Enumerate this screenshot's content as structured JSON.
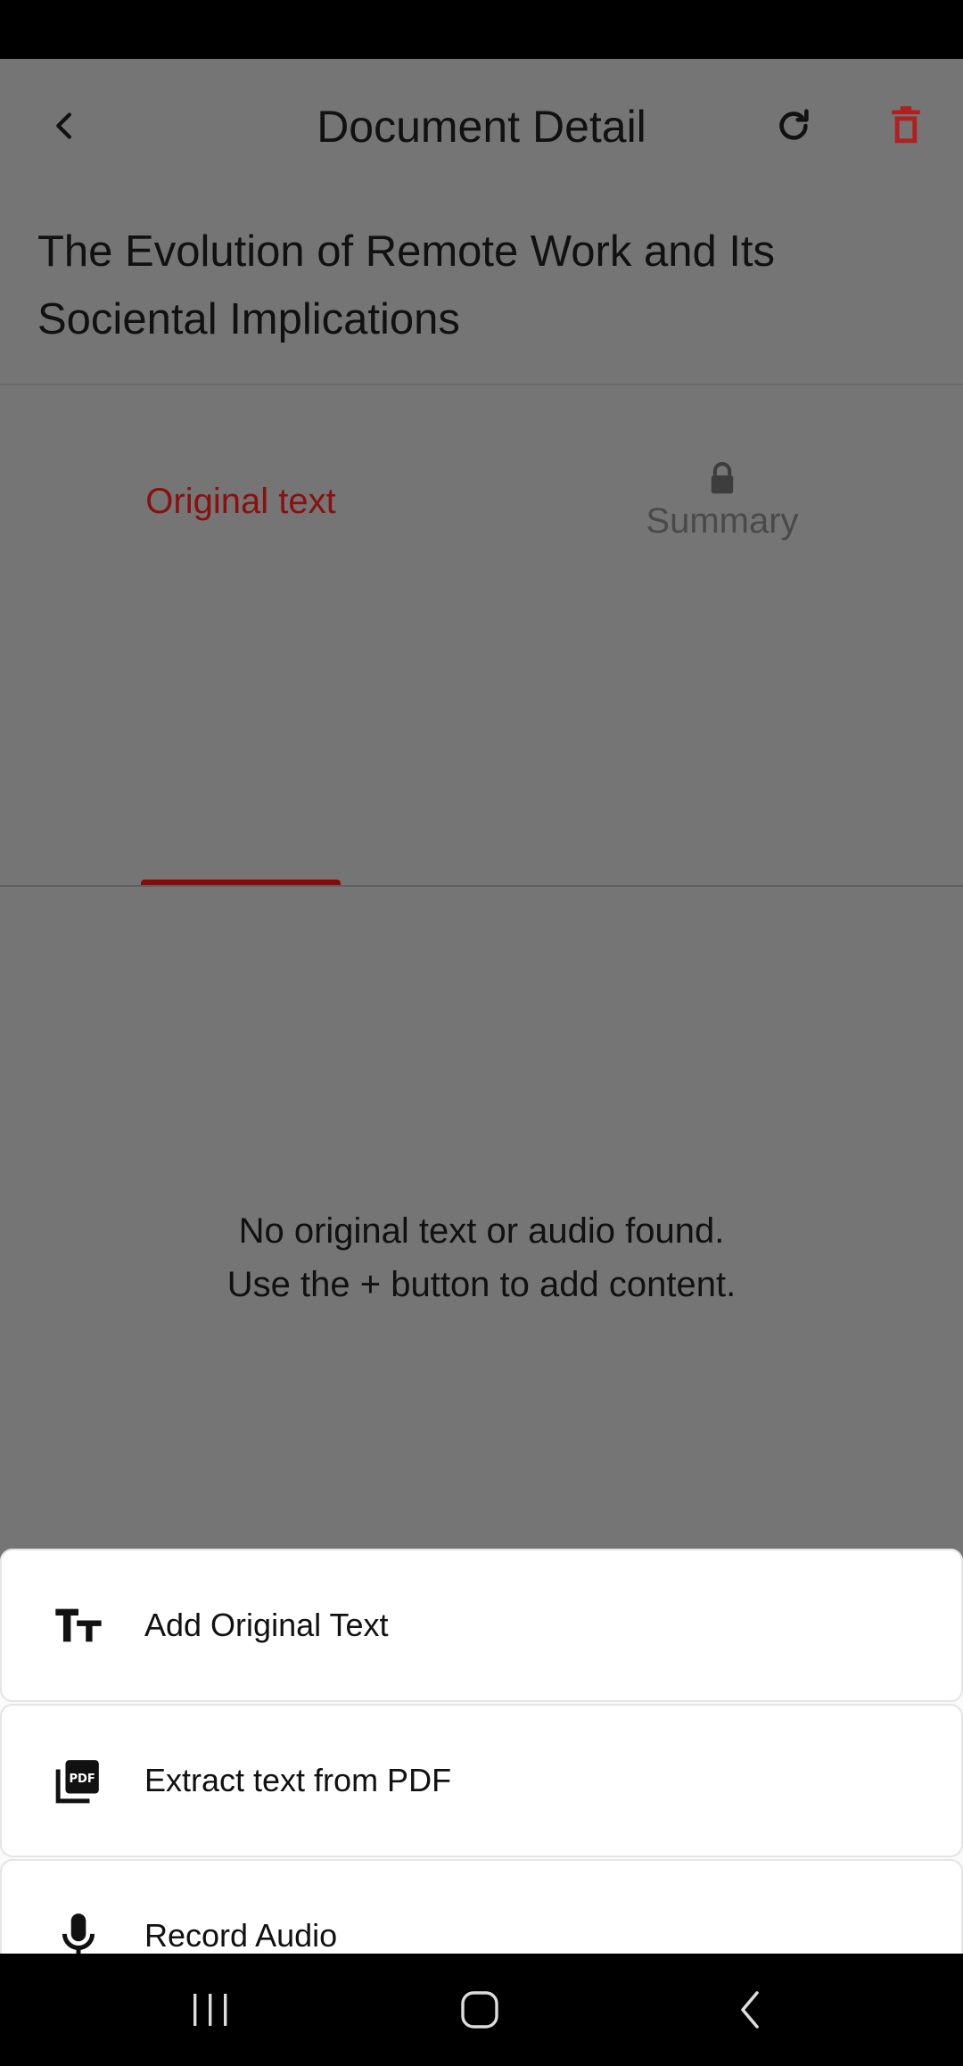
{
  "app_bar": {
    "title": "Document Detail",
    "icons": {
      "back": "back-chevron-icon",
      "refresh": "refresh-icon",
      "delete": "trash-icon"
    },
    "delete_color": "#c62828"
  },
  "document": {
    "title": "The Evolution of Remote Work and Its Sociental Implications"
  },
  "tabs": [
    {
      "label": "Original text",
      "active": true,
      "locked": false
    },
    {
      "label": "Summary",
      "active": false,
      "locked": true,
      "icon": "lock-icon"
    }
  ],
  "empty_state": {
    "line1": "No original text or audio found.",
    "line2": "Use the + button to add content."
  },
  "sheet": {
    "items": [
      {
        "label": "Add Original Text",
        "icon": "text-size-icon"
      },
      {
        "label": "Extract text from PDF",
        "icon": "pdf-icon"
      },
      {
        "label": "Record Audio",
        "icon": "microphone-icon"
      }
    ]
  },
  "nav": {
    "icons": [
      "recent-apps-icon",
      "home-icon",
      "back-icon"
    ]
  },
  "colors": {
    "accent": "#8a0a0a",
    "overlay": "#757575",
    "sheet": "#ffffff"
  }
}
